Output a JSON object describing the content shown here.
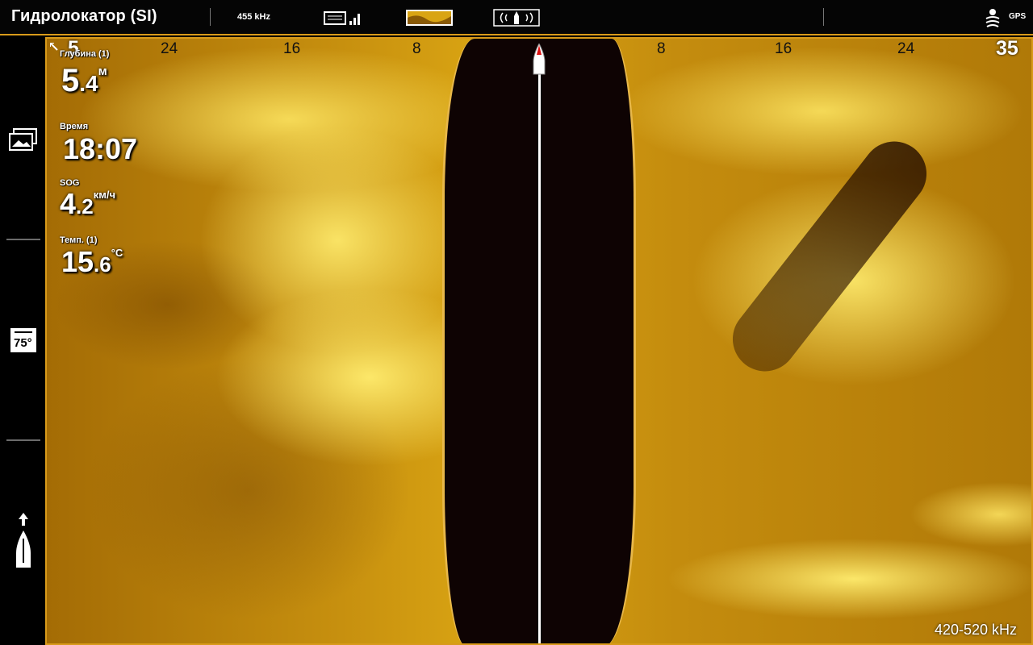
{
  "header": {
    "title": "Гидролокатор (SI)",
    "frequency": "455 kHz",
    "gps_label": "GPS"
  },
  "sidebar": {
    "cone_angle": "75°"
  },
  "sonar": {
    "range_left_edge": "5",
    "range_right_edge": "35",
    "range_ticks_left": [
      "24",
      "16",
      "8"
    ],
    "range_ticks_right": [
      "8",
      "16",
      "24"
    ],
    "frequency_range": "420-520 kHz"
  },
  "readouts": {
    "depth": {
      "label": "Глубина (1)",
      "int": "5",
      "dec": ".4",
      "unit": "м"
    },
    "time": {
      "label": "Время",
      "value": "18:07"
    },
    "sog": {
      "label": "SOG",
      "int": "4",
      "dec": ".2",
      "unit": "км/ч"
    },
    "temp": {
      "label": "Темп. (1)",
      "int": "15",
      "dec": ".6",
      "unit": "°C"
    }
  },
  "colors": {
    "accent": "#d89a1a",
    "sonar_highlight": "#ffec6e",
    "sonar_base": "#c48c0e",
    "water_column": "#0e0303"
  }
}
